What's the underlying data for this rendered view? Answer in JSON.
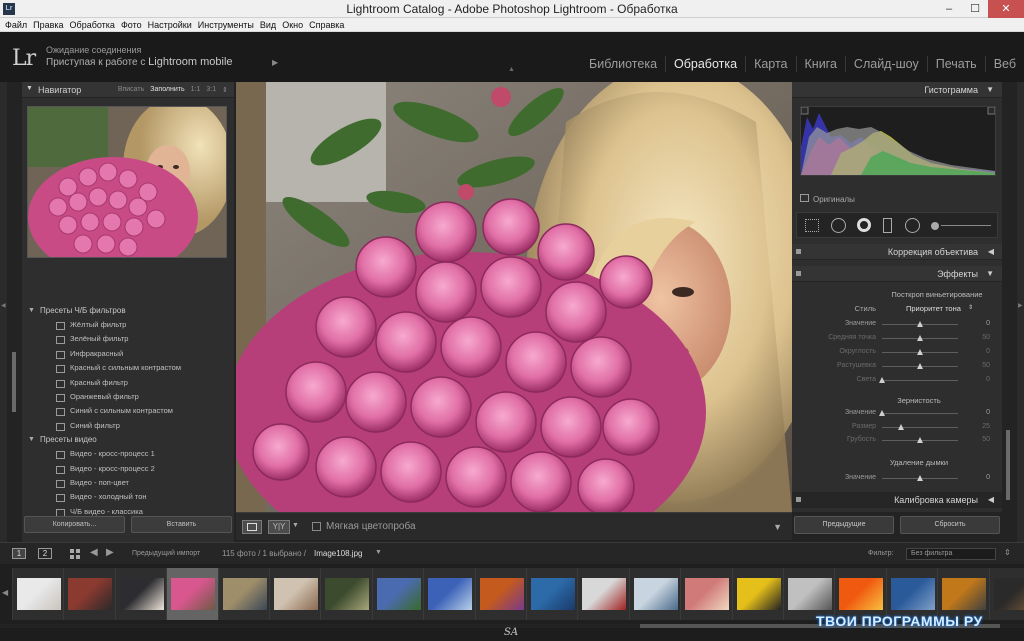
{
  "window": {
    "title": "Lightroom Catalog - Adobe Photoshop Lightroom - Обработка",
    "app_icon": "Lr"
  },
  "menu": [
    "Файл",
    "Правка",
    "Обработка",
    "Фото",
    "Настройки",
    "Инструменты",
    "Вид",
    "Окно",
    "Справка"
  ],
  "header": {
    "logo": "Lr",
    "status_line1": "Ожидание соединения",
    "status_prefix": "Приступая к работе с",
    "status_app": "Lightroom mobile",
    "modules": [
      "Библиотека",
      "Обработка",
      "Карта",
      "Книга",
      "Слайд-шоу",
      "Печать",
      "Веб"
    ],
    "active_module": "Обработка"
  },
  "navigator": {
    "title": "Навигатор",
    "options": [
      "Вписать",
      "Заполнить",
      "1:1",
      "3:1"
    ],
    "selected_option": "Заполнить"
  },
  "presets": {
    "folder1": "Пресеты Ч/Б фильтров",
    "items1": [
      "Жёлтый фильтр",
      "Зелёный фильтр",
      "Инфракрасный",
      "Красный с сильным контрастом",
      "Красный фильтр",
      "Оранжевый фильтр",
      "Синий с сильным контрастом",
      "Синий фильтр"
    ],
    "folder2": "Пресеты видео",
    "items2": [
      "Видео - кросс-процесс 1",
      "Видео - кросс-процесс 2",
      "Видео - поп-цвет",
      "Видео - холодный тон",
      "Ч/Б видео - классика"
    ]
  },
  "left_buttons": {
    "copy": "Копировать...",
    "paste": "Вставить"
  },
  "toolbar": {
    "compare": "Y|Y",
    "soft_proof": "Мягкая цветопроба"
  },
  "right_panel": {
    "histogram": "Гистограмма",
    "originals": "Оригиналы",
    "lens_correction": "Коррекция объектива",
    "effects": "Эффекты",
    "vignette": {
      "title": "Посткроп виньетирование",
      "style_label": "Стиль",
      "style_value": "Приоритет тона",
      "sliders": [
        {
          "name": "Значение",
          "value": "0",
          "pos": 0.5,
          "dim": false
        },
        {
          "name": "Средняя точка",
          "value": "50",
          "pos": 0.5,
          "dim": true
        },
        {
          "name": "Округлость",
          "value": "0",
          "pos": 0.5,
          "dim": true
        },
        {
          "name": "Растушевка",
          "value": "50",
          "pos": 0.5,
          "dim": true
        },
        {
          "name": "Света",
          "value": "0",
          "pos": 0.0,
          "dim": true
        }
      ]
    },
    "grain": {
      "title": "Зернистость",
      "sliders": [
        {
          "name": "Значение",
          "value": "0",
          "pos": 0.0,
          "dim": false
        },
        {
          "name": "Размер",
          "value": "25",
          "pos": 0.25,
          "dim": true
        },
        {
          "name": "Грубость",
          "value": "50",
          "pos": 0.5,
          "dim": true
        }
      ]
    },
    "dehaze": {
      "title": "Удаление дымки",
      "sliders": [
        {
          "name": "Значение",
          "value": "0",
          "pos": 0.5,
          "dim": false
        }
      ]
    },
    "camera_calibration": "Калибровка камеры",
    "buttons": {
      "previous": "Предыдущие",
      "reset": "Сбросить"
    }
  },
  "filmstrip_bar": {
    "monitor1": "1",
    "monitor2": "2",
    "prev_import": "Предыдущий импорт",
    "count": "115 фото / 1 выбрано /",
    "filename": "Image108.jpg",
    "filter_label": "Фильтр:",
    "filter_value": "Без фильтра"
  },
  "thumbnails": [
    {
      "c1": "#e9e9ea",
      "c2": "#c9c3bd"
    },
    {
      "c1": "#8b3a30",
      "c2": "#2a2a2a"
    },
    {
      "c1": "#2d2d31",
      "c2": "#f0e6dc"
    },
    {
      "c1": "#d9578f",
      "c2": "#6e5a44",
      "selected": true
    },
    {
      "c1": "#9f8e6a",
      "c2": "#3b4756"
    },
    {
      "c1": "#d0c2b0",
      "c2": "#8a6a50"
    },
    {
      "c1": "#3c4a2e",
      "c2": "#a7a77a"
    },
    {
      "c1": "#4b6bb0",
      "c2": "#3b6a2a"
    },
    {
      "c1": "#3c62b8",
      "c2": "#b8d0e8"
    },
    {
      "c1": "#c45a1e",
      "c2": "#7a3a8a"
    },
    {
      "c1": "#2c6aa8",
      "c2": "#1a3a6a"
    },
    {
      "c1": "#d8d8d8",
      "c2": "#a02020"
    },
    {
      "c1": "#c8d4e0",
      "c2": "#4a6a8a"
    },
    {
      "c1": "#d07a7a",
      "c2": "#f0d8c0"
    },
    {
      "c1": "#e6c01a",
      "c2": "#222222"
    },
    {
      "c1": "#c0c0c0",
      "c2": "#555555"
    },
    {
      "c1": "#f05a10",
      "c2": "#f8c040"
    },
    {
      "c1": "#2a5a9a",
      "c2": "#80a0c8"
    },
    {
      "c1": "#c0781a",
      "c2": "#404040"
    },
    {
      "c1": "#2a2a2a",
      "c2": "#7a5a3a"
    }
  ],
  "footer": {
    "initials": "SA",
    "watermark": "ТВОИ ПРОГРАММЫ РУ"
  }
}
